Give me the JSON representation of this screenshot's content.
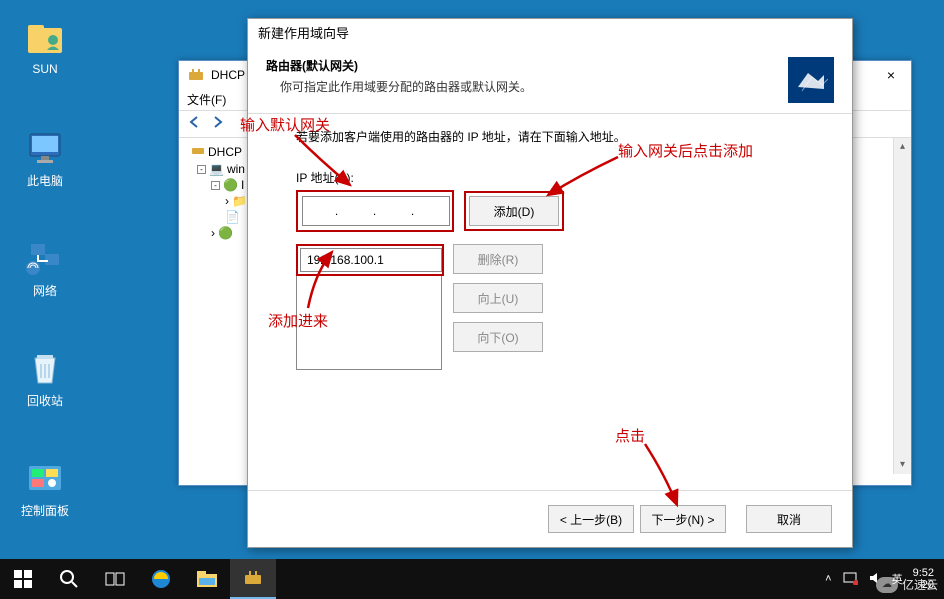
{
  "desktop": {
    "sun": "SUN",
    "pc": "此电脑",
    "net": "网络",
    "recycle": "回收站",
    "cp": "控制面板"
  },
  "mmc": {
    "title": "DHCP",
    "menu_file": "文件(F)",
    "close": "×",
    "tree": {
      "root": "DHCP",
      "server": "win",
      "ipv4_short": "I"
    }
  },
  "wizard": {
    "title": "新建作用域向导",
    "header_h1": "路由器(默认网关)",
    "header_h2": "你可指定此作用域要分配的路由器或默认网关。",
    "instruct": "若要添加客户端使用的路由器的 IP 地址，请在下面输入地址。",
    "ip_label": "IP 地址(P):",
    "ip_value": "   .     .     .   ",
    "list_value": "192.168.100.1",
    "btn_add": "添加(D)",
    "btn_remove": "删除(R)",
    "btn_up": "向上(U)",
    "btn_down": "向下(O)",
    "btn_back": "< 上一步(B)",
    "btn_next": "下一步(N) >",
    "btn_cancel": "取消"
  },
  "annotations": {
    "a1": "输入默认网关",
    "a2": "输入网关后点击添加",
    "a3": "添加进来",
    "a4": "点击"
  },
  "taskbar": {
    "ime": "英",
    "time": "9:52",
    "date_partial": "20"
  },
  "watermark": "亿速云"
}
